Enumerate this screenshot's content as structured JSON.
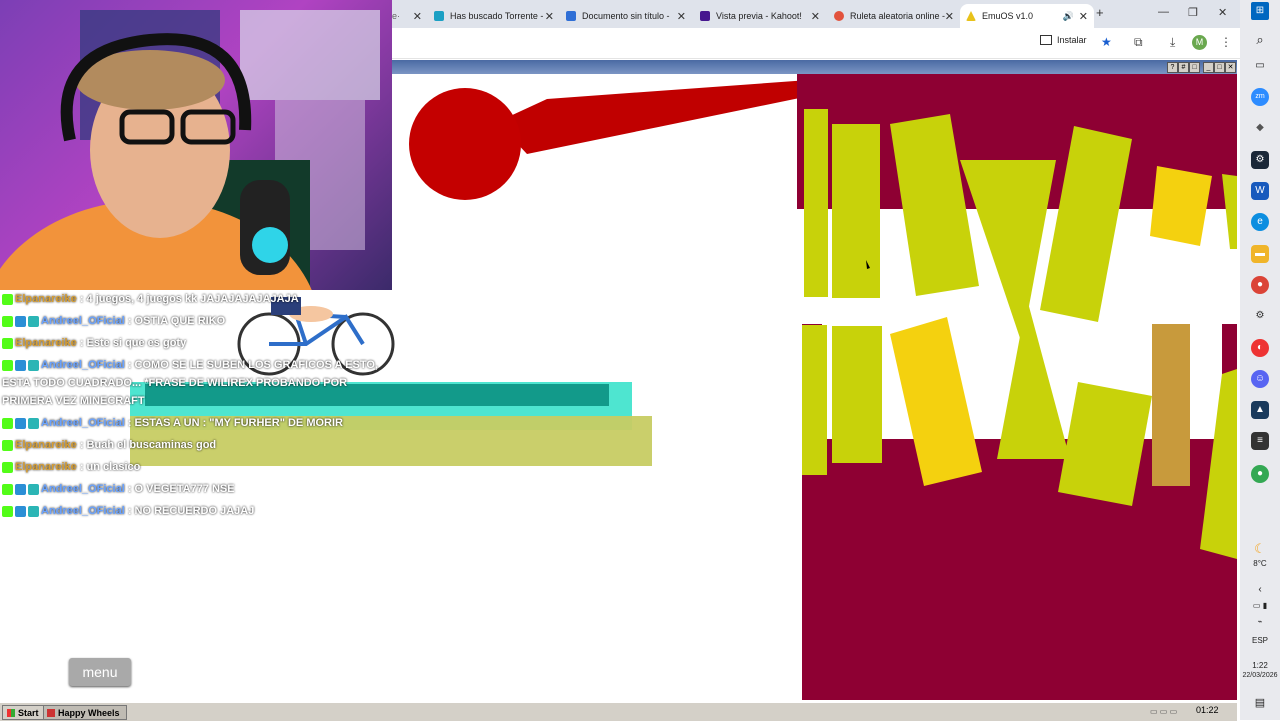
{
  "browser": {
    "tabs": [
      {
        "label": "Has buscado Torrente - ",
        "color": "#1ba0c4"
      },
      {
        "label": "Documento sin título - ",
        "color": "#2f6fd6"
      },
      {
        "label": "Vista previa - Kahoot!",
        "color": "#46178f"
      },
      {
        "label": "Ruleta aleatoria online - ",
        "color": "#e2523c"
      },
      {
        "label": "EmuOS v1.0",
        "color": "#e8c21a"
      }
    ],
    "new_tab": "+",
    "install_label": "Instalar",
    "profile_initial": "M"
  },
  "emulator": {
    "taskbar": {
      "start_label": "Start",
      "task_label": "Happy Wheels",
      "clock": "01:22"
    },
    "menu_label": "menu"
  },
  "chat": {
    "messages": [
      {
        "user": "Elpanareike",
        "text": ": 4 juegos, 4 juegos kk JAJAJAJAJAJAJA",
        "style": "o"
      },
      {
        "user": "Andreel_OFicial",
        "text": ": OSTIA QUE RIKO",
        "style": "b"
      },
      {
        "user": "Elpanareike",
        "text": ": Este si que es goty",
        "style": "o"
      },
      {
        "user": "Andreel_OFicial",
        "text": ": COMO SE LE SUBEN LOS GRAFICOS A ESTO,",
        "style": "b"
      },
      {
        "user": "",
        "text": "ESTA TODO CUADRADO... *FRASE DE WILIREX PROBANDO POR",
        "style": "cont"
      },
      {
        "user": "",
        "text": "PRIMERA VEZ MINECRAFT",
        "style": "cont"
      },
      {
        "user": "Andreel_OFicial",
        "text": ": ESTAS A UN : \"MY FURHER\" DE MORIR",
        "style": "b"
      },
      {
        "user": "Elpanareike",
        "text": ": Buah el buscaminas god",
        "style": "o"
      },
      {
        "user": "Elpanareike",
        "text": ": un clasico",
        "style": "o"
      },
      {
        "user": "Andreel_OFicial",
        "text": ": O VEGETA777 NSE",
        "style": "b"
      },
      {
        "user": "Andreel_OFicial",
        "text": ": NO RECUERDO JAJAJ",
        "style": "b"
      }
    ]
  },
  "system": {
    "temperature": "8°C",
    "language": "ESP",
    "time": "1:22",
    "date": "22/03/2026"
  }
}
